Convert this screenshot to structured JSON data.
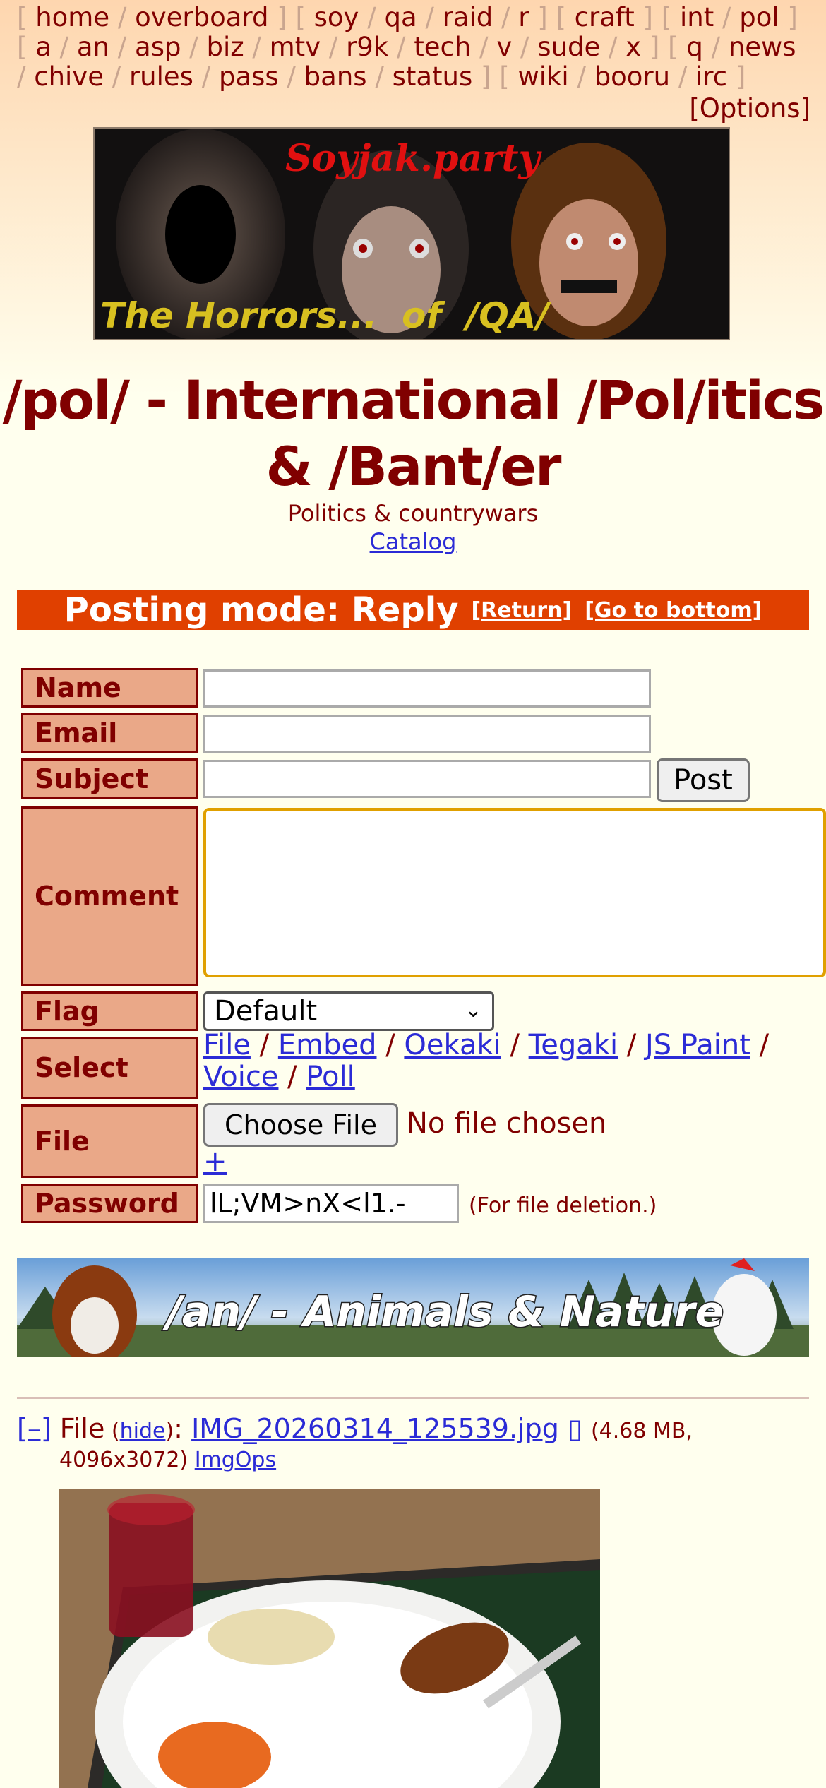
{
  "boardlist": {
    "groups": [
      [
        "home",
        "overboard"
      ],
      [
        "soy",
        "qa",
        "raid",
        "r"
      ],
      [
        "craft"
      ],
      [
        "int",
        "pol"
      ],
      [
        "a",
        "an",
        "asp",
        "biz",
        "mtv",
        "r9k",
        "tech",
        "v",
        "sude",
        "x"
      ],
      [
        "q",
        "news",
        "chive",
        "rules",
        "pass",
        "bans",
        "status"
      ],
      [
        "wiki",
        "booru",
        "irc"
      ]
    ],
    "options": "[Options]"
  },
  "banner": {
    "top_text": "Soyjak.party",
    "bottom_text": "The Horrors...  of  /QA/"
  },
  "board": {
    "title": "/pol/ - International /Pol/itics & /Bant/er",
    "subtitle": "Politics & countrywars",
    "catalog": "Catalog"
  },
  "posting_mode": {
    "label": "Posting mode: Reply",
    "return": "[Return]",
    "go_bottom": "[Go to bottom]"
  },
  "form": {
    "name_label": "Name",
    "email_label": "Email",
    "subject_label": "Subject",
    "post_button": "Post",
    "comment_label": "Comment",
    "flag_label": "Flag",
    "flag_value": "Default",
    "select_label": "Select",
    "select_options": [
      "File",
      "Embed",
      "Oekaki",
      "Tegaki",
      "JS Paint",
      "Voice",
      "Poll"
    ],
    "file_label": "File",
    "choose_file": "Choose File",
    "no_file": "No file chosen",
    "plus": "+",
    "password_label": "Password",
    "password_value": "lL;VM>nX<l1.-",
    "password_note": "(For file deletion.)"
  },
  "ad_banner": {
    "text": "/an/ - Animals & Nature"
  },
  "post": {
    "toggle": "[–]",
    "file_label": "File",
    "hide": "hide",
    "filename": "IMG_20260314_125539.jpg",
    "size": "(4.68 MB,",
    "dimensions": "4096x3072)",
    "imgops": "ImgOps"
  },
  "colors": {
    "background": "#ffffee",
    "maroon": "#800000",
    "postmode_bar": "#e04000",
    "label_bg": "#eaa888",
    "link": "#2b2bd6"
  }
}
